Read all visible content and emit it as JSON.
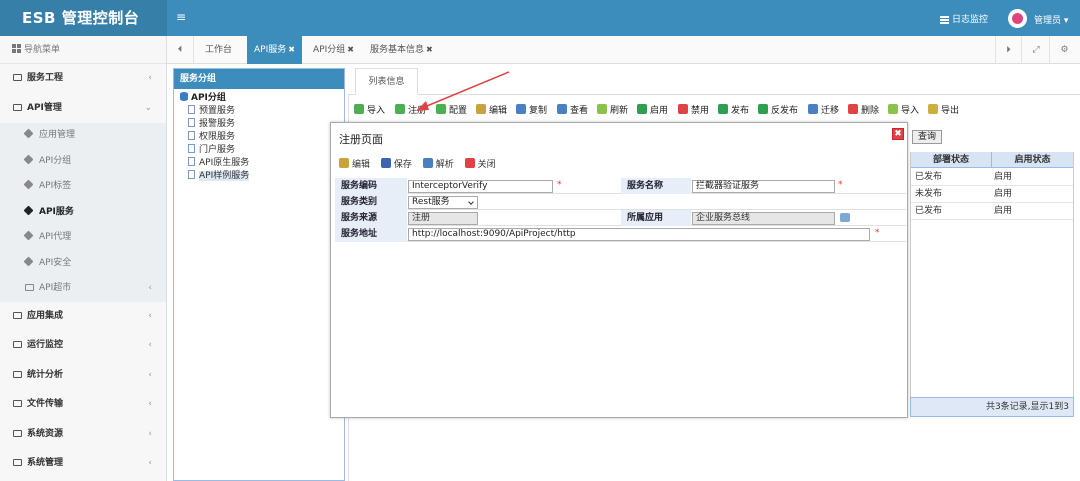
{
  "header": {
    "logo": "ESB 管理控制台",
    "menu_icon": "≡",
    "log_link": "日志监控",
    "user": "管理员 ▾"
  },
  "sidebar": {
    "title": "导航菜单",
    "items": [
      {
        "label": "服务工程",
        "arrow": "‹"
      },
      {
        "label": "API管理",
        "arrow": "⌄"
      },
      {
        "label": "应用集成",
        "arrow": "‹"
      },
      {
        "label": "运行监控",
        "arrow": "‹"
      },
      {
        "label": "统计分析",
        "arrow": "‹"
      },
      {
        "label": "文件传输",
        "arrow": "‹"
      },
      {
        "label": "系统资源",
        "arrow": "‹"
      },
      {
        "label": "系统管理",
        "arrow": "‹"
      }
    ],
    "api_children": [
      {
        "label": "应用管理"
      },
      {
        "label": "API分组"
      },
      {
        "label": "API标签"
      },
      {
        "label": "API服务"
      },
      {
        "label": "API代理"
      },
      {
        "label": "API安全"
      },
      {
        "label": "API超市",
        "arrow": "‹"
      }
    ]
  },
  "tabs": {
    "prev": "⏴",
    "items": [
      {
        "label": "工作台"
      },
      {
        "label": "API服务",
        "close": "✖"
      },
      {
        "label": "API分组",
        "close": "✖"
      },
      {
        "label": "服务基本信息",
        "close": "✖"
      }
    ],
    "next": "⏵",
    "expand": "⤢",
    "settings": "⚙"
  },
  "group_panel": {
    "title": "服务分组",
    "root": "API分组",
    "nodes": [
      "预置服务",
      "报警服务",
      "权限服务",
      "门户服务",
      "API原生服务",
      "API样例服务"
    ]
  },
  "main": {
    "tab_label": "列表信息",
    "toolbar": [
      {
        "label": "导入",
        "color": "#4caf50"
      },
      {
        "label": "注册",
        "color": "#4caf50"
      },
      {
        "label": "配置",
        "color": "#4caf50"
      },
      {
        "label": "编辑",
        "color": "#c9a23c"
      },
      {
        "label": "复制",
        "color": "#4a7fc0"
      },
      {
        "label": "查看",
        "color": "#4a7fc0"
      },
      {
        "label": "刷新",
        "color": "#8bc34a"
      },
      {
        "label": "启用",
        "color": "#2e9e4f"
      },
      {
        "label": "禁用",
        "color": "#e04343"
      },
      {
        "label": "发布",
        "color": "#2e9e4f"
      },
      {
        "label": "反发布",
        "color": "#2e9e4f"
      },
      {
        "label": "迁移",
        "color": "#4a7fc0"
      },
      {
        "label": "删除",
        "color": "#e04343"
      },
      {
        "label": "导入",
        "color": "#8bc34a"
      },
      {
        "label": "导出",
        "color": "#c9b13c"
      }
    ],
    "search_button": "查询",
    "grid": {
      "columns": [
        "部署状态",
        "启用状态"
      ],
      "rows": [
        [
          "已发布",
          "启用"
        ],
        [
          "未发布",
          "启用"
        ],
        [
          "已发布",
          "启用"
        ]
      ],
      "pager": "共3条记录,显示1到3"
    }
  },
  "dialog": {
    "title": "注册页面",
    "close": "✖",
    "tools": [
      {
        "label": "编辑",
        "color": "#c9a23c"
      },
      {
        "label": "保存",
        "color": "#3a64b0"
      },
      {
        "label": "解析",
        "color": "#4a7fc0"
      },
      {
        "label": "关闭",
        "color": "#e04343"
      }
    ],
    "fields": {
      "code_label": "服务编码",
      "code_value": "InterceptorVerify",
      "name_label": "服务名称",
      "name_value": "拦截器验证服务",
      "type_label": "服务类别",
      "type_value": "Rest服务",
      "source_label": "服务来源",
      "source_value": "注册",
      "app_label": "所属应用",
      "app_value": "企业服务总线",
      "addr_label": "服务地址",
      "addr_value": "http://localhost:9090/ApiProject/http",
      "required_mark": "*"
    }
  },
  "colors": {
    "header": "#3c8dbc",
    "logo_bg": "#367fa9",
    "annotation": "#e04343"
  }
}
